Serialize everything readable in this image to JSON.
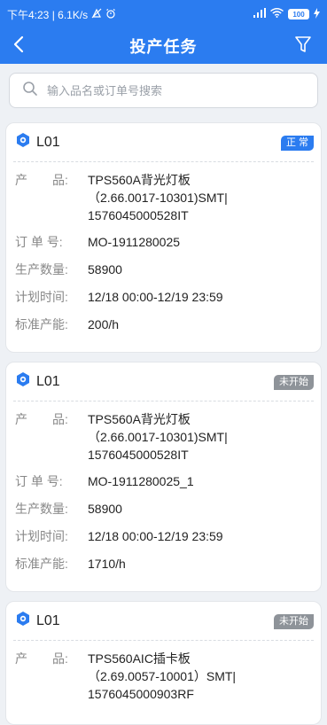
{
  "status_bar": {
    "time_speed": "下午4:23 | 6.1K/s",
    "battery": "100"
  },
  "nav": {
    "title": "投产任务"
  },
  "search": {
    "placeholder": "输入品名或订单号搜索"
  },
  "labels": {
    "product": "产　　品:",
    "order": "订 单 号:",
    "qty": "生产数量:",
    "plan": "计划时间:",
    "capacity": "标准产能:"
  },
  "colors": {
    "primary": "#2b7cf0",
    "badge_normal": "#2b7cf0",
    "badge_pending": "#8e9399"
  },
  "tasks": [
    {
      "line": "L01",
      "status": "正 常",
      "product_line1": "TPS560A背光灯板",
      "product_line2": "（2.66.0017-10301)SMT|",
      "product_line3": "1576045000528IT",
      "order": "MO-1911280025",
      "qty": "58900",
      "plan": "12/18 00:00-12/19 23:59",
      "capacity": "200/h"
    },
    {
      "line": "L01",
      "status": "未开始",
      "product_line1": "TPS560A背光灯板",
      "product_line2": "（2.66.0017-10301)SMT|",
      "product_line3": "1576045000528IT",
      "order": "MO-1911280025_1",
      "qty": "58900",
      "plan": "12/18 00:00-12/19 23:59",
      "capacity": "1710/h"
    },
    {
      "line": "L01",
      "status": "未开始",
      "product_line1": "TPS560AIC插卡板",
      "product_line2": "（2.69.0057-10001）SMT|",
      "product_line3": "1576045000903RF"
    }
  ]
}
